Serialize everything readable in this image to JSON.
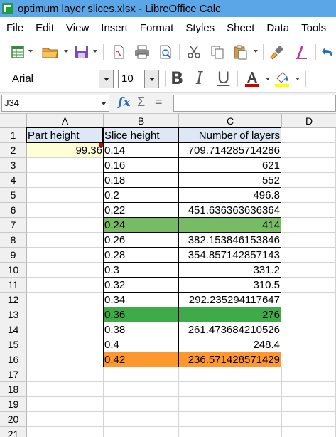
{
  "window": {
    "title": "optimum layer slices.xlsx - LibreOffice Calc"
  },
  "menu": [
    "File",
    "Edit",
    "View",
    "Insert",
    "Format",
    "Styles",
    "Sheet",
    "Data",
    "Tools"
  ],
  "toolbar": {
    "icons": [
      "new-spreadsheet-icon",
      "open-folder-icon",
      "save-icon",
      "export-pdf-icon",
      "print-icon",
      "print-preview-icon",
      "cut-icon",
      "copy-icon",
      "paste-icon",
      "clone-formatting-icon",
      "clear-formatting-icon",
      "undo-icon"
    ]
  },
  "format": {
    "font_name": "Arial",
    "font_size": "10",
    "bold": "B",
    "italic": "I",
    "underline": "U",
    "font_color": "#cc0000",
    "highlight_color": "#ffff00"
  },
  "formula_bar": {
    "name_box": "J34",
    "fx": "fx",
    "sigma": "Σ",
    "equals": "=",
    "value": ""
  },
  "sheet": {
    "columns": [
      "A",
      "B",
      "C",
      "D"
    ],
    "rows": [
      "1",
      "2",
      "3",
      "4",
      "5",
      "6",
      "7",
      "8",
      "9",
      "10",
      "11",
      "12",
      "13",
      "14",
      "15",
      "16",
      "17",
      "18",
      "19",
      "20",
      "21"
    ],
    "headers": {
      "a1": "Part height",
      "b1": "Slice height",
      "c1": "Number of layers"
    },
    "part_height": "99.36",
    "data": [
      {
        "slice": "0.14",
        "layers": "709.714285714286",
        "fill": ""
      },
      {
        "slice": "0.16",
        "layers": "621",
        "fill": ""
      },
      {
        "slice": "0.18",
        "layers": "552",
        "fill": ""
      },
      {
        "slice": "0.2",
        "layers": "496.8",
        "fill": ""
      },
      {
        "slice": "0.22",
        "layers": "451.636363636364",
        "fill": ""
      },
      {
        "slice": "0.24",
        "layers": "414",
        "fill": "#77bc65"
      },
      {
        "slice": "0.26",
        "layers": "382.153846153846",
        "fill": ""
      },
      {
        "slice": "0.28",
        "layers": "354.857142857143",
        "fill": ""
      },
      {
        "slice": "0.3",
        "layers": "331.2",
        "fill": ""
      },
      {
        "slice": "0.32",
        "layers": "310.5",
        "fill": ""
      },
      {
        "slice": "0.34",
        "layers": "292.235294117647",
        "fill": ""
      },
      {
        "slice": "0.36",
        "layers": "276",
        "fill": "#3faa48"
      },
      {
        "slice": "0.38",
        "layers": "261.473684210526",
        "fill": ""
      },
      {
        "slice": "0.4",
        "layers": "248.4",
        "fill": ""
      },
      {
        "slice": "0.42",
        "layers": "236.571428571429",
        "fill": "#ff972f"
      }
    ],
    "header_fill": "#dde8f4",
    "part_height_fill": "#ffffd7"
  }
}
